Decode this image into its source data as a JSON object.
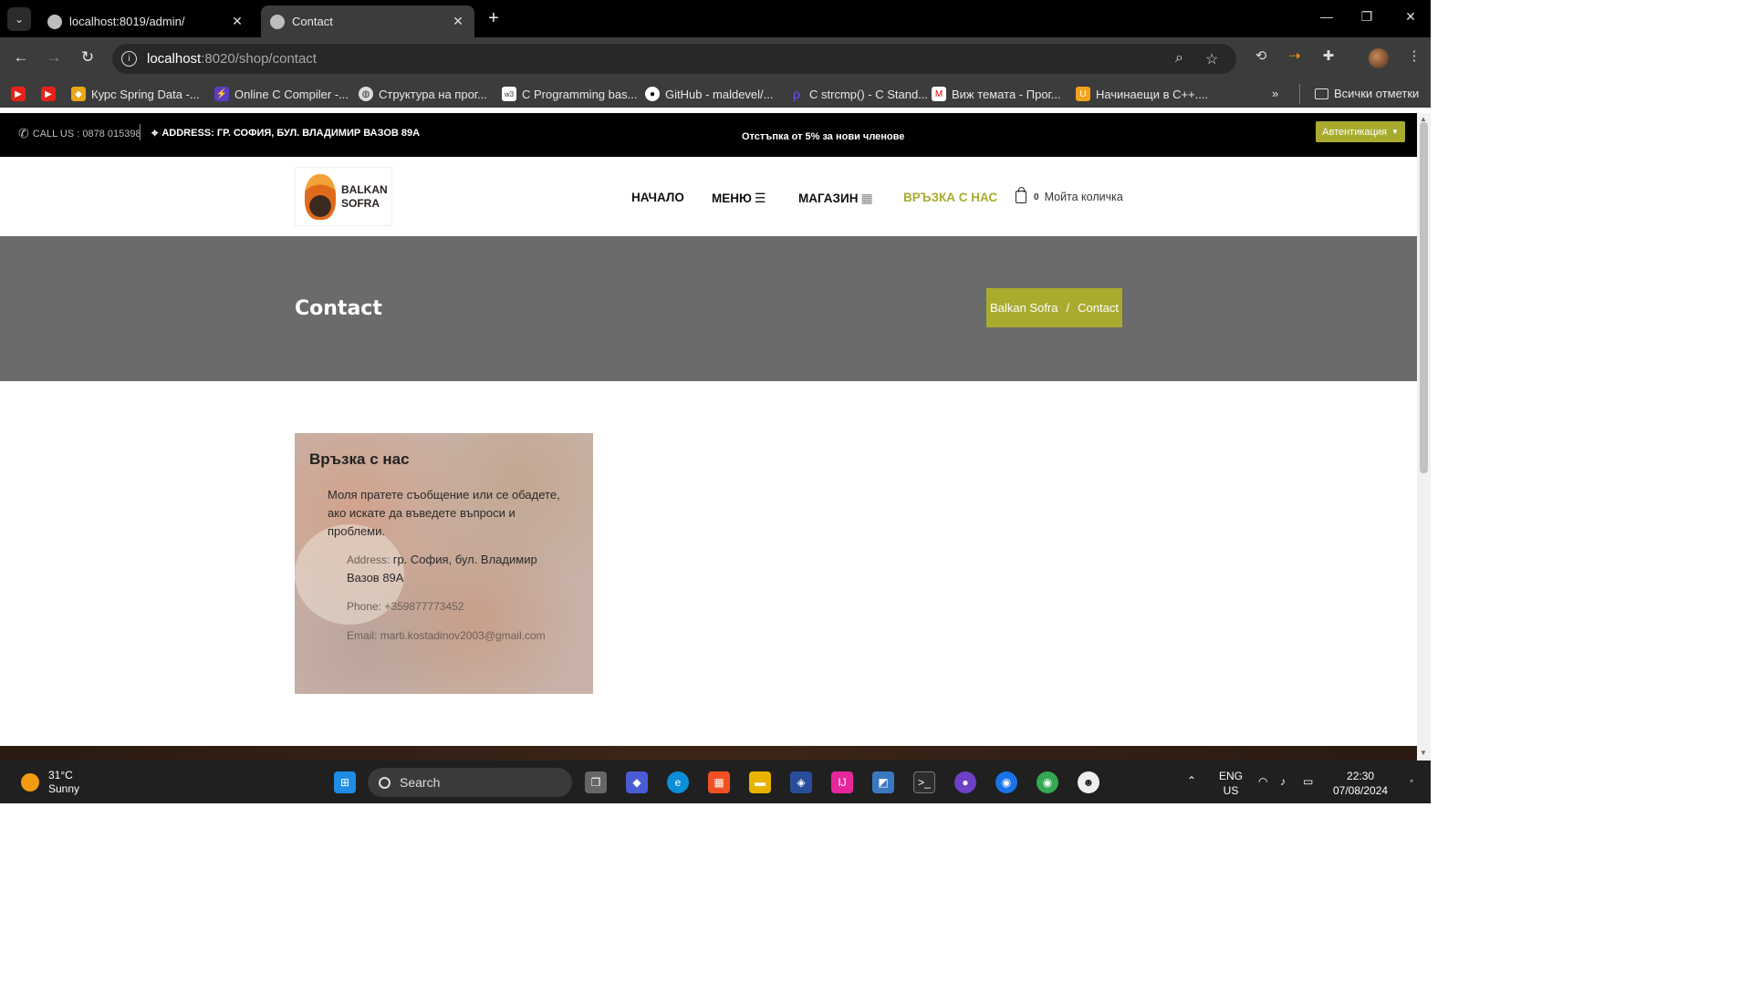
{
  "browser": {
    "tabs": [
      {
        "title": "localhost:8019/admin/",
        "active": false
      },
      {
        "title": "Contact",
        "active": true
      }
    ],
    "url_host": "localhost",
    "url_path": ":8020/shop/contact",
    "bookmarks": [
      {
        "label": "Курс Spring Data -...",
        "icon": "spring-icon"
      },
      {
        "label": "Online C Compiler -...",
        "icon": "compiler-icon"
      },
      {
        "label": "Структура на прог...",
        "icon": "globe-icon"
      },
      {
        "label": "C Programming bas...",
        "icon": "w3-icon"
      },
      {
        "label": "GitHub - maldevel/...",
        "icon": "github-icon"
      },
      {
        "label": "C strcmp() - C Stand...",
        "icon": "programiz-icon"
      },
      {
        "label": "Виж темата - Прог...",
        "icon": "forum-icon"
      },
      {
        "label": "Начинаещи в C++....",
        "icon": "udemy-icon"
      }
    ],
    "all_bookmarks": "Всички отметки"
  },
  "site": {
    "topbar": {
      "phone": "CALL US : 0878 015398",
      "address": "ADDRESS: ГР. СОФИЯ, БУЛ. ВЛАДИМИР ВАЗОВ 89А",
      "promo": "Отстъпка от 5% за нови членове",
      "auth": "Автентикация"
    },
    "logo_line1": "BALKAN",
    "logo_line2": "SOFRA",
    "nav": {
      "home": "НАЧАЛО",
      "menu": "МЕНЮ",
      "shop": "МАГАЗИН",
      "contact": "ВРЪЗКА С НАС",
      "cart_count": "0",
      "cart_label": "Мойта количка"
    },
    "hero": {
      "title": "Contact",
      "crumb_home": "Balkan Sofra",
      "crumb_sep": "/",
      "crumb_current": "Contact"
    },
    "contact_card": {
      "title": "Връзка с нас",
      "message": "Моля пратете съобщение или се обадете, ако искате да въведете въпроси и проблеми.",
      "address_label": "Address:",
      "address_value": "гр. София, бул. Владимир Вазов 89А",
      "phone_label": "Phone:",
      "phone_value": "+359877773452",
      "email_label": "Email:",
      "email_value": "marti.kostadinov2003@gmail.com"
    }
  },
  "taskbar": {
    "temperature": "31°C",
    "condition": "Sunny",
    "search": "Search",
    "lang1": "ENG",
    "lang2": "US",
    "time": "22:30",
    "date": "07/08/2024"
  },
  "colors": {
    "accent": "#a9ab2f",
    "hero_bg": "#6b6b6b",
    "topbar_bg": "#000000"
  }
}
